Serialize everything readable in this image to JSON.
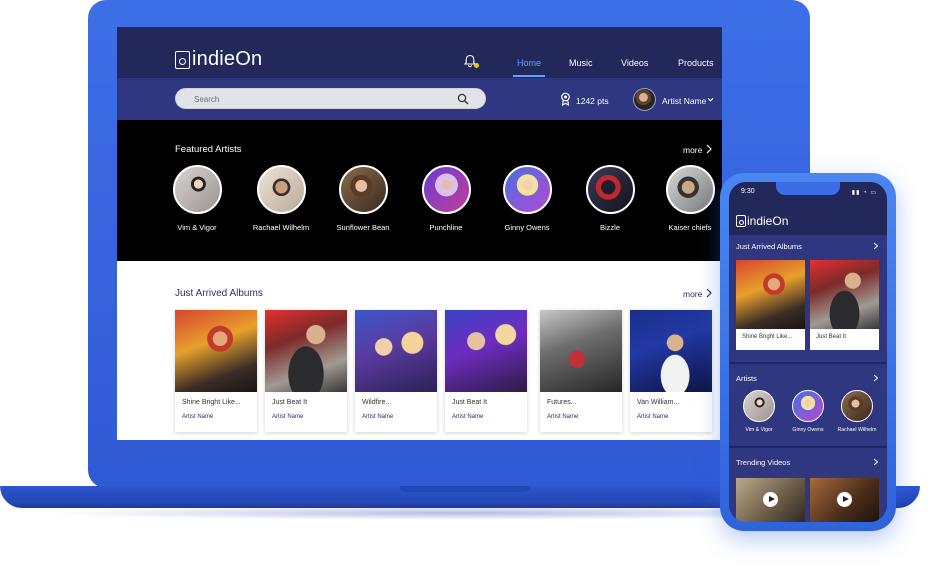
{
  "laptop": {
    "logo": "indieOn",
    "nav": [
      "Home",
      "Music",
      "Videos",
      "Products"
    ],
    "search_placeholder": "Search",
    "points": "1242 pts",
    "user_name": "Artist Name",
    "featured": {
      "title": "Featured Artists",
      "more": "more",
      "artists": [
        "Vim & Vigor",
        "Rachael Wilhelm",
        "Sunflower Bean",
        "Punchline",
        "Ginny Owens",
        "Bizzle",
        "Kaiser chiefs"
      ]
    },
    "albums": {
      "title": "Just Arrived Albums",
      "more": "more",
      "items": [
        {
          "title": "Shine Bright Like...",
          "artist": "Artist Name"
        },
        {
          "title": "Just Beat It",
          "artist": "Artist Name"
        },
        {
          "title": "Wildfire...",
          "artist": "Artist Name"
        },
        {
          "title": "Just Beat It",
          "artist": "Artist Name"
        },
        {
          "title": "Futures...",
          "artist": "Artist Name"
        },
        {
          "title": "Van William...",
          "artist": "Artist Name"
        }
      ]
    }
  },
  "phone": {
    "time": "9:30",
    "logo": "indieOn",
    "albums_title": "Just Arrived Albums",
    "albums": [
      "Shine Bright Like...",
      "Just Beat It"
    ],
    "artists_title": "Artists",
    "artists": [
      "Vim & Vigor",
      "Ginny Owens",
      "Rachael Wilhelm"
    ],
    "videos_title": "Trending Videos"
  },
  "colors": {
    "device_blue": "#3d6fe7",
    "header_navy": "#22295a",
    "subbar_navy": "#2e3780",
    "active_nav": "#5aa3ff",
    "notification_dot": "#f0c419"
  }
}
